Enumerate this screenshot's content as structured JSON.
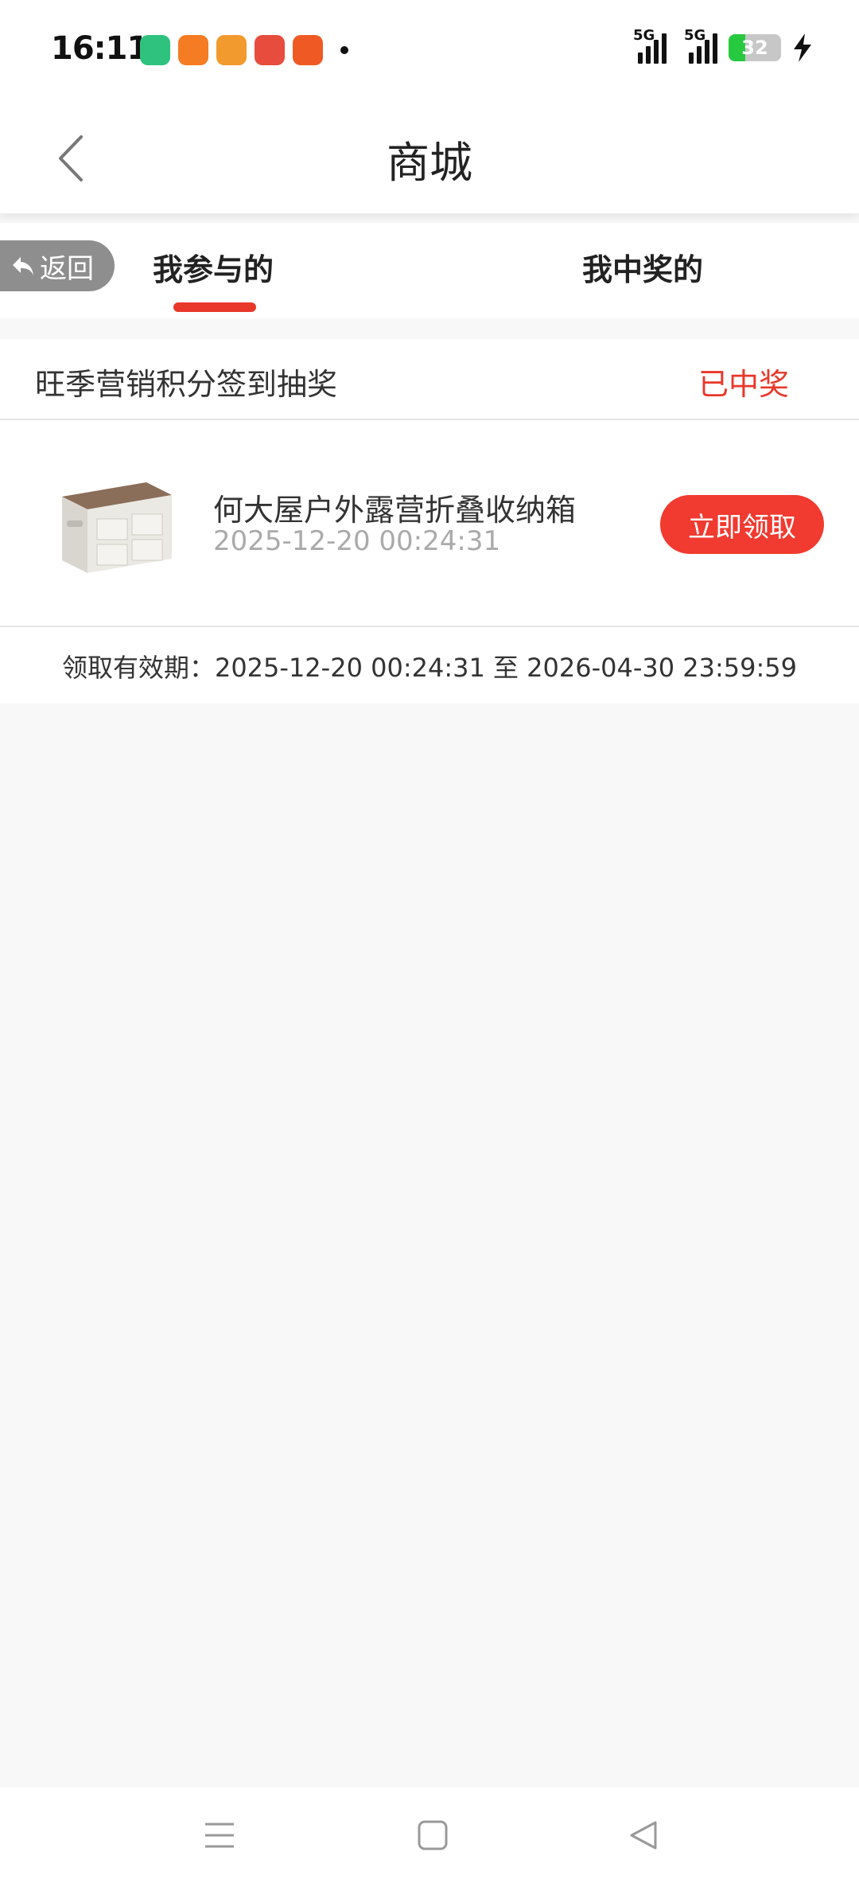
{
  "status_bar": {
    "time": "16:11",
    "network1": "5G",
    "network2": "5G",
    "battery": "32",
    "icons": [
      "battery-saver-app-icon",
      "orange-app-icon",
      "game-app-icon",
      "pig-app-icon",
      "send-app-icon"
    ]
  },
  "nav": {
    "title": "商城"
  },
  "tabs": {
    "back_label": "返回",
    "items": [
      {
        "label": "我参与的",
        "active": true
      },
      {
        "label": "我中奖的",
        "active": false
      }
    ]
  },
  "record": {
    "activity_name": "旺季营销积分签到抽奖",
    "status": "已中奖",
    "prize_name": "何大屋户外露营折叠收纳箱",
    "prize_time": "2025-12-20 00:24:31",
    "claim_label": "立即领取",
    "validity": "领取有效期：2025-12-20 00:24:31 至 2026-04-30 23:59:59"
  },
  "colors": {
    "accent": "#e8382b",
    "button": "#f13a30",
    "background": "#f8f8f8"
  }
}
